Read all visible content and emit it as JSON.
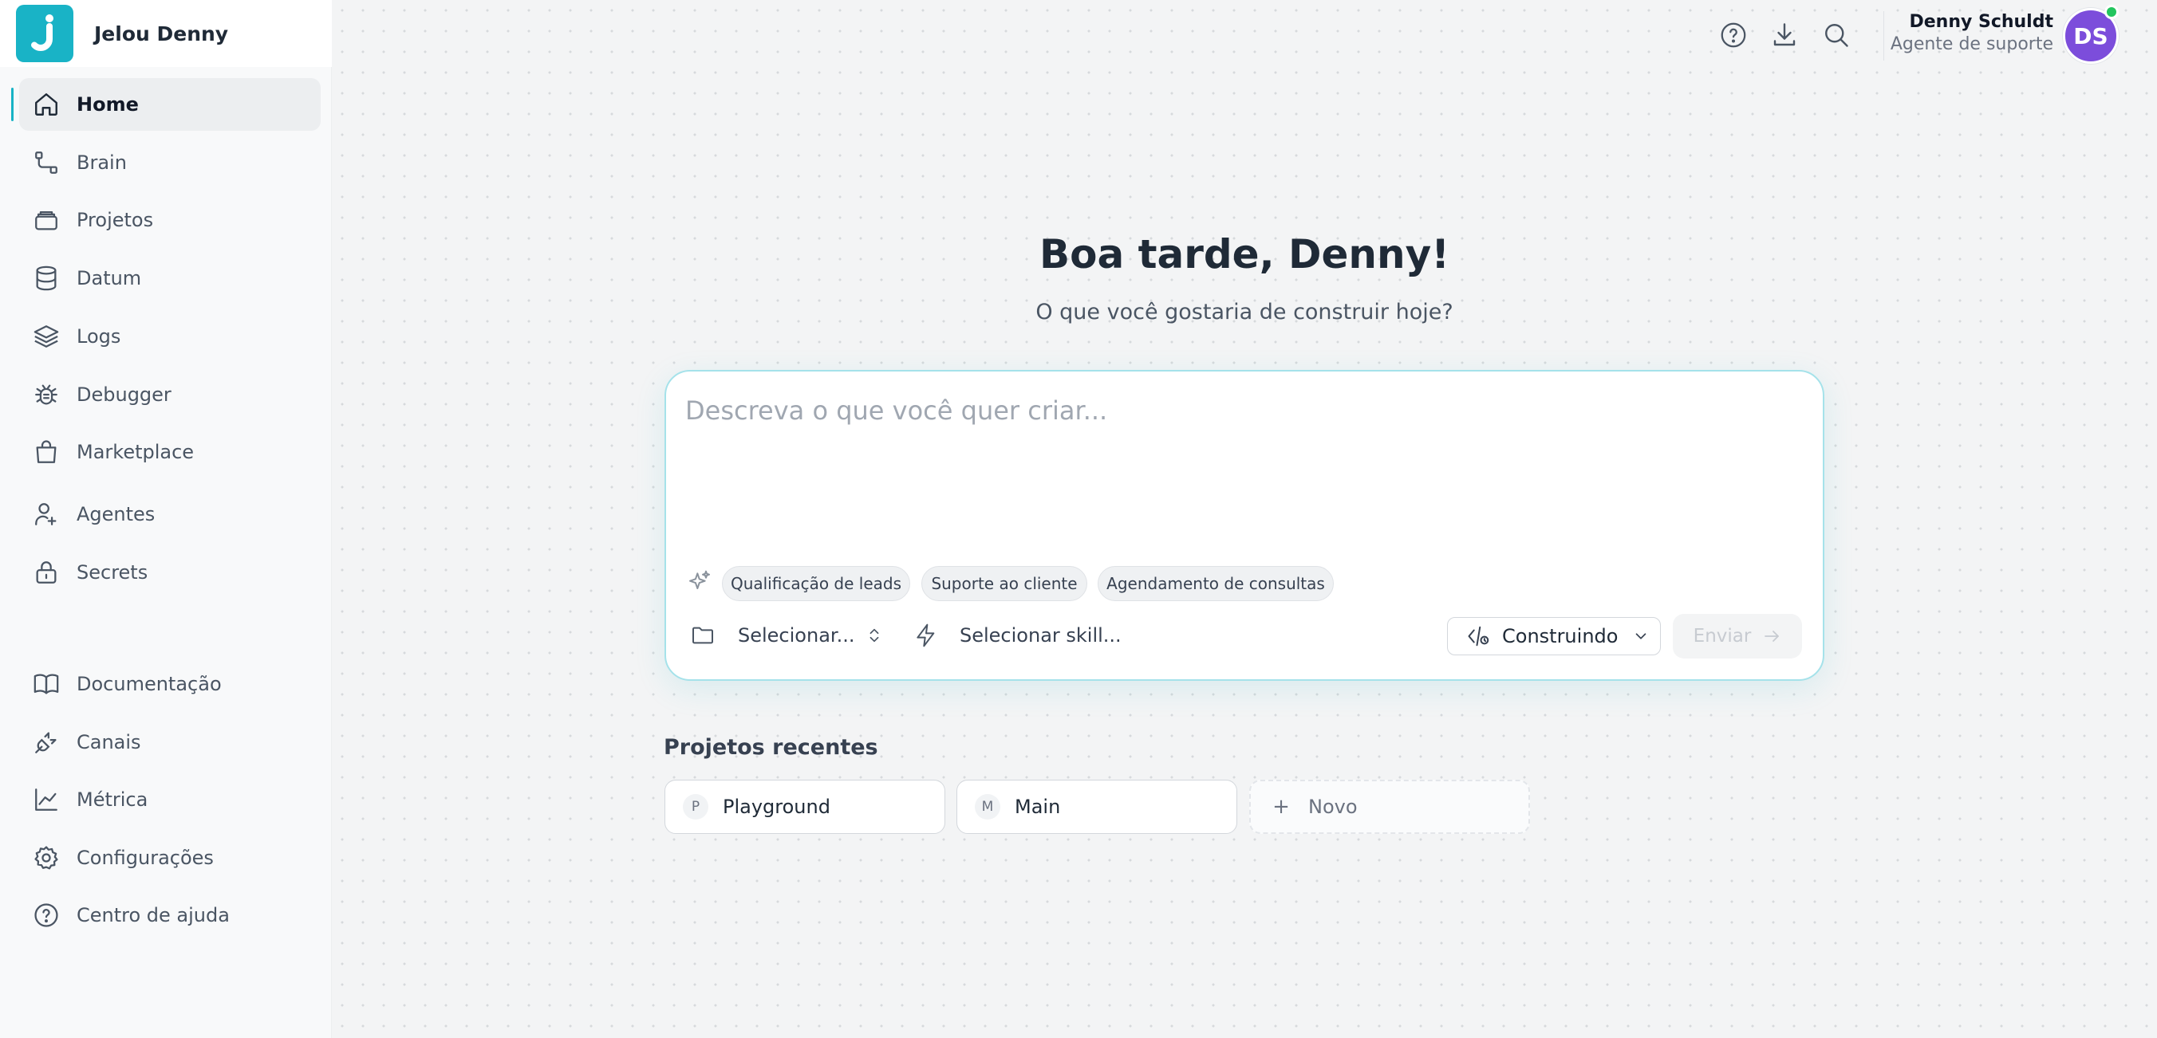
{
  "brand": {
    "logo_letter": "J",
    "name": "Jelou Denny"
  },
  "nav": {
    "main": [
      {
        "label": "Home",
        "icon": "home-icon",
        "active": true
      },
      {
        "label": "Brain",
        "icon": "flow-icon"
      },
      {
        "label": "Projetos",
        "icon": "stack-icon"
      },
      {
        "label": "Datum",
        "icon": "database-icon"
      },
      {
        "label": "Logs",
        "icon": "layers-icon"
      },
      {
        "label": "Debugger",
        "icon": "bug-icon"
      },
      {
        "label": "Marketplace",
        "icon": "shopping-bag-icon"
      },
      {
        "label": "Agentes",
        "icon": "user-plus-icon"
      },
      {
        "label": "Secrets",
        "icon": "lock-icon"
      }
    ],
    "bottom": [
      {
        "label": "Documentação",
        "icon": "book-icon"
      },
      {
        "label": "Canais",
        "icon": "plug-icon"
      },
      {
        "label": "Métrica",
        "icon": "chart-icon"
      },
      {
        "label": "Configurações",
        "icon": "gear-icon"
      },
      {
        "label": "Centro de ajuda",
        "icon": "help-circle-icon"
      }
    ]
  },
  "topbar": {
    "icons": [
      "help-icon",
      "download-icon",
      "search-icon"
    ],
    "user": {
      "name": "Denny Schuldt",
      "role": "Agente de suporte",
      "initials": "DS",
      "status": "online"
    }
  },
  "hero": {
    "greeting": "Boa tarde, Denny!",
    "subtitle": "O que você gostaria de construir hoje?"
  },
  "composer": {
    "placeholder": "Descreva o que você quer criar...",
    "value": "",
    "suggestions": [
      "Qualificação de leads",
      "Suporte ao cliente",
      "Agendamento de consultas"
    ],
    "project_select": "Selecionar...",
    "skill_select": "Selecionar skill...",
    "mode": "Construindo",
    "send_label": "Enviar"
  },
  "recent": {
    "title": "Projetos recentes",
    "projects": [
      {
        "initial": "P",
        "name": "Playground"
      },
      {
        "initial": "M",
        "name": "Main"
      }
    ],
    "new_label": "Novo",
    "new_icon": "+"
  },
  "colors": {
    "accent": "#19b3c6",
    "avatar": "#7c4ddb",
    "online": "#22c55e"
  }
}
